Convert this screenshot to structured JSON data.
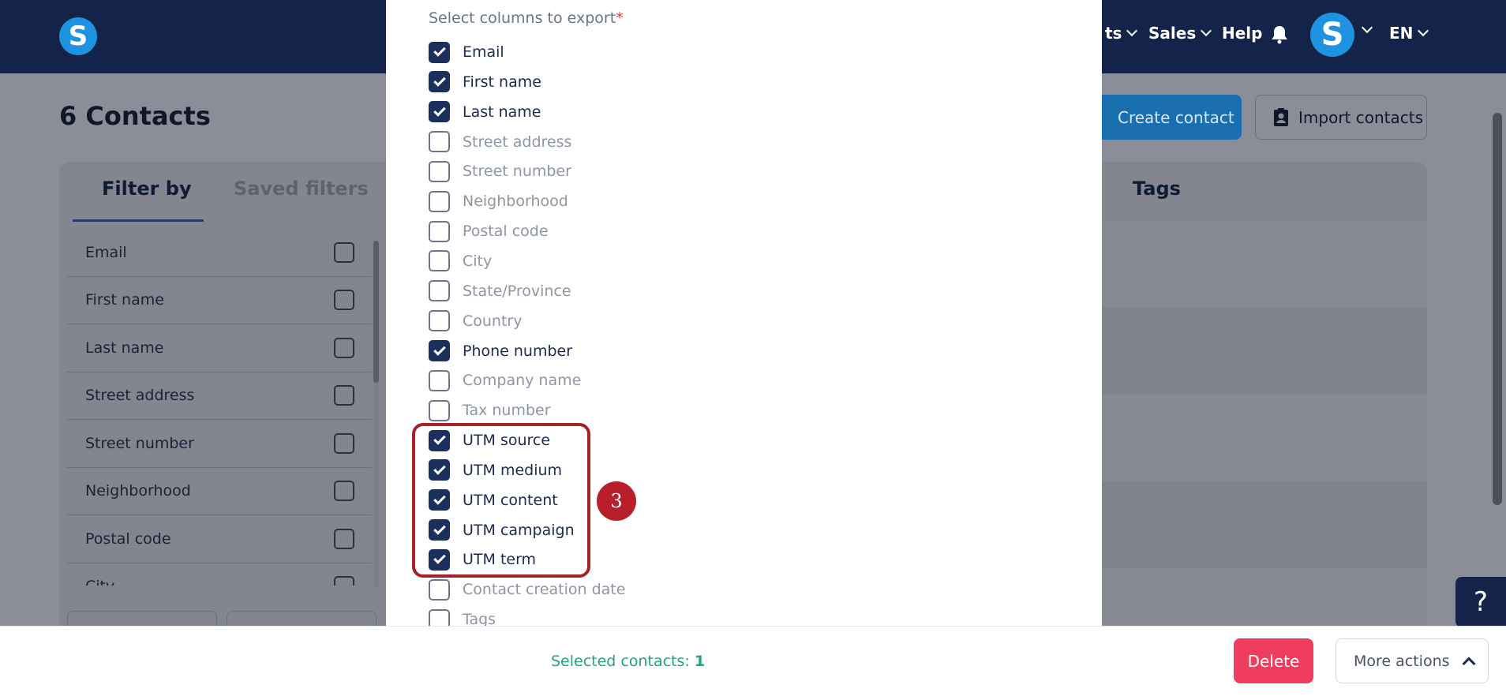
{
  "nav": {
    "logo_letter": "S",
    "items": [
      {
        "label": "ts",
        "has_dropdown": true
      },
      {
        "label": "Sales",
        "has_dropdown": true
      },
      {
        "label": "Help",
        "has_dropdown": false
      }
    ],
    "avatar_letter": "S",
    "language": "EN",
    "bell_icon": "bell-icon"
  },
  "page": {
    "title": "6 Contacts",
    "create_button": "Create contact",
    "import_button": "Import contacts"
  },
  "filters": {
    "tabs": [
      "Filter by",
      "Saved filters"
    ],
    "tags_header": "Tags",
    "items": [
      "Email",
      "First name",
      "Last name",
      "Street address",
      "Street number",
      "Neighborhood",
      "Postal code",
      "City"
    ]
  },
  "export_modal": {
    "label": "Select columns to export",
    "required_marker": "*",
    "options": [
      {
        "label": "Email",
        "checked": true
      },
      {
        "label": "First name",
        "checked": true
      },
      {
        "label": "Last name",
        "checked": true
      },
      {
        "label": "Street address",
        "checked": false
      },
      {
        "label": "Street number",
        "checked": false
      },
      {
        "label": "Neighborhood",
        "checked": false
      },
      {
        "label": "Postal code",
        "checked": false
      },
      {
        "label": "City",
        "checked": false
      },
      {
        "label": "State/Province",
        "checked": false
      },
      {
        "label": "Country",
        "checked": false
      },
      {
        "label": "Phone number",
        "checked": true
      },
      {
        "label": "Company name",
        "checked": false
      },
      {
        "label": "Tax number",
        "checked": false
      },
      {
        "label": "UTM source",
        "checked": true
      },
      {
        "label": "UTM medium",
        "checked": true
      },
      {
        "label": "UTM content",
        "checked": true
      },
      {
        "label": "UTM campaign",
        "checked": true
      },
      {
        "label": "UTM term",
        "checked": true
      },
      {
        "label": "Contact creation date",
        "checked": false
      },
      {
        "label": "Tags",
        "checked": false
      }
    ],
    "step_number": "3"
  },
  "help_button": "?",
  "bottom_bar": {
    "selected_label": "Selected contacts: ",
    "selected_count": "1",
    "delete_button": "Delete",
    "more_actions_button": "More actions"
  },
  "colors": {
    "navy": "#14234a",
    "brand_blue": "#1d93e1",
    "checkbox_checked": "#1a2f5c",
    "highlight_red": "#a8202a",
    "delete_pink": "#ee3d5e",
    "selected_green": "#22a673"
  }
}
